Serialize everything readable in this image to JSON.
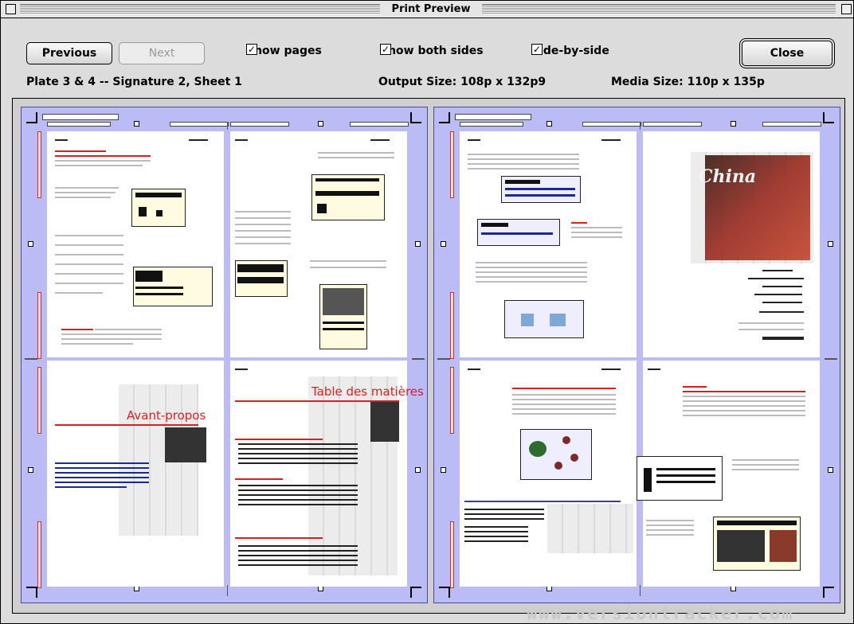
{
  "window": {
    "title": "Print Preview"
  },
  "toolbar": {
    "previous_label": "Previous",
    "next_label": "Next",
    "close_label": "Close",
    "show_pages": {
      "label": "Show pages",
      "checked": true
    },
    "show_both_sides": {
      "label": "Show both sides",
      "checked": true
    },
    "side_by_side": {
      "label": "Side-by-side",
      "checked": true
    }
  },
  "info": {
    "plate": "Plate 3 & 4 -- Signature 2, Sheet 1",
    "output_size": "Output Size: 108p x 132p9",
    "media_size": "Media Size: 110p x 135p"
  },
  "pages": {
    "avant_propos_title": "Avant-propos",
    "table_title": "Table des matières"
  },
  "cover": {
    "logo_text": "China"
  },
  "watermark": "www.versiontracker.com",
  "colors": {
    "spread_background": "#bbbcf6",
    "accent_red": "#d82020",
    "window_gray": "#dcdcdc"
  }
}
